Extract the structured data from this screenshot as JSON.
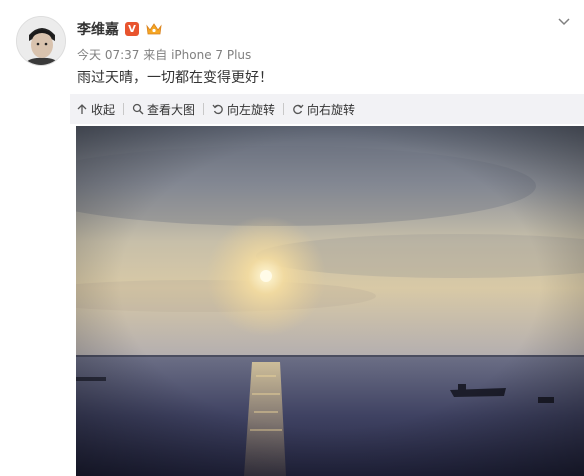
{
  "post": {
    "username": "李维嘉",
    "verified_badge": "V",
    "time": "今天 07:37",
    "source_prefix": "来自",
    "source": "iPhone 7 Plus",
    "text": "雨过天晴，一切都在变得更好！"
  },
  "toolbar": {
    "items": [
      {
        "label": "收起",
        "icon": "collapse-icon"
      },
      {
        "label": "查看大图",
        "icon": "search-icon"
      },
      {
        "label": "向左旋转",
        "icon": "rotate-left-icon"
      },
      {
        "label": "向右旋转",
        "icon": "rotate-right-icon"
      }
    ]
  },
  "colors": {
    "verified": "#e8542e",
    "toolbar_bg": "#f2f2f5",
    "meta_text": "#808080"
  }
}
